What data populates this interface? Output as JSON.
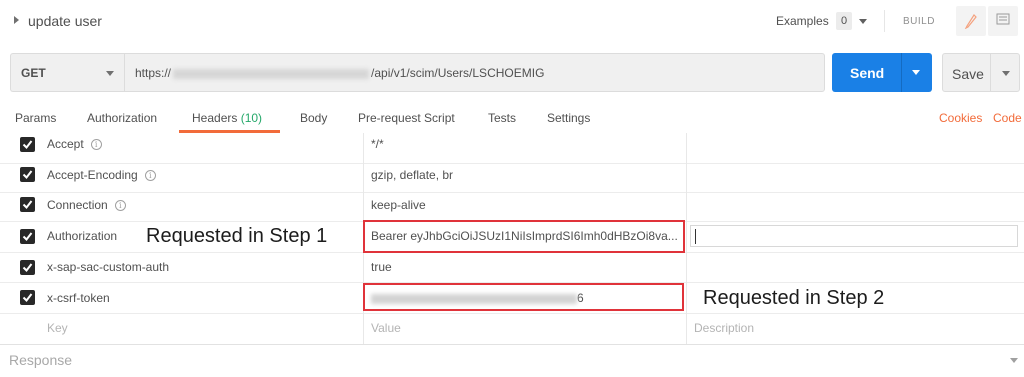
{
  "request": {
    "title": "update user"
  },
  "toolbar": {
    "examples_label": "Examples",
    "examples_count": "0",
    "build_label": "BUILD"
  },
  "url_bar": {
    "method": "GET",
    "url_prefix": "https://",
    "url_suffix": "/api/v1/scim/Users/LSCHOEMIG",
    "send_label": "Send",
    "save_label": "Save"
  },
  "tabs": [
    {
      "label": "Params"
    },
    {
      "label": "Authorization"
    },
    {
      "label": "Headers",
      "count": "(10)"
    },
    {
      "label": "Body"
    },
    {
      "label": "Pre-request Script"
    },
    {
      "label": "Tests"
    },
    {
      "label": "Settings"
    }
  ],
  "links": {
    "cookies": "Cookies",
    "code": "Code"
  },
  "headers": [
    {
      "key": "Accept",
      "value": "*/*",
      "checked": true,
      "info": true
    },
    {
      "key": "Accept-Encoding",
      "value": "gzip, deflate, br",
      "checked": true,
      "info": true
    },
    {
      "key": "Connection",
      "value": "keep-alive",
      "checked": true,
      "info": true
    },
    {
      "key": "Authorization",
      "value": "Bearer eyJhbGciOiJSUzI1NiIsImprdSI6Imh0dHBzOi8va...",
      "checked": true,
      "info": false
    },
    {
      "key": "x-sap-sac-custom-auth",
      "value": "true",
      "checked": true,
      "info": false
    },
    {
      "key": "x-csrf-token",
      "value_suffix": "6",
      "checked": true,
      "info": false
    }
  ],
  "placeholders": {
    "key": "Key",
    "value": "Value",
    "description": "Description"
  },
  "annotations": {
    "step1": "Requested in Step 1",
    "step2": "Requested in Step 2"
  },
  "response": {
    "label": "Response"
  },
  "colors": {
    "send": "#1a80e6",
    "accent": "#f26b3a",
    "annotation": "#e0333a",
    "count": "#25a86a"
  }
}
